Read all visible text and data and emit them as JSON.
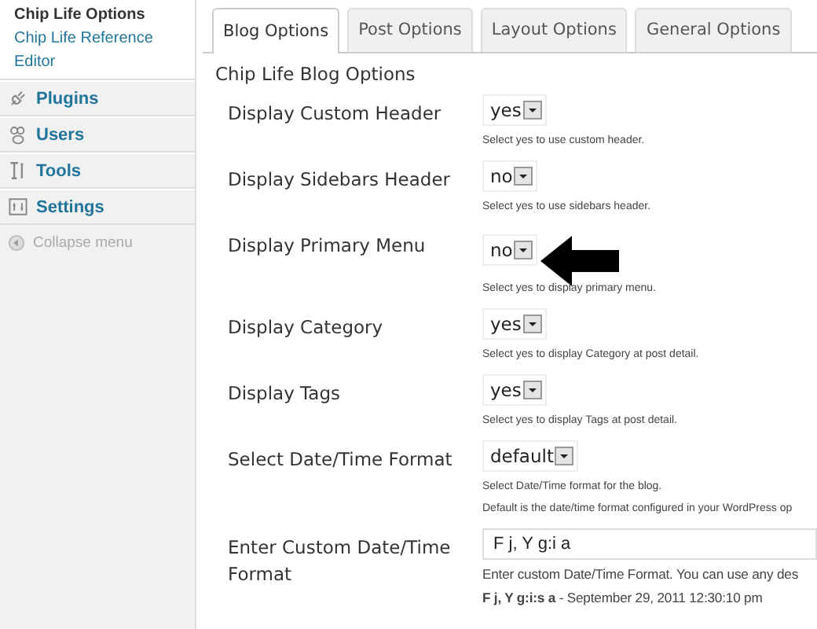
{
  "sidebar": {
    "submenu": [
      {
        "label": "Chip Life Options",
        "selected": true
      },
      {
        "label": "Chip Life Reference",
        "selected": false
      },
      {
        "label": "Editor",
        "selected": false
      }
    ],
    "items": [
      {
        "label": "Plugins"
      },
      {
        "label": "Users"
      },
      {
        "label": "Tools"
      },
      {
        "label": "Settings"
      }
    ],
    "collapse": "Collapse menu"
  },
  "tabs": [
    {
      "label": "Blog Options",
      "selected": true
    },
    {
      "label": "Post Options",
      "selected": false
    },
    {
      "label": "Layout Options",
      "selected": false
    },
    {
      "label": "General Options",
      "selected": false
    }
  ],
  "heading": "Chip Life Blog Options",
  "options": [
    {
      "kind": "select",
      "label": "Display Custom Header",
      "value": "yes",
      "help": [
        "Select yes to use custom header."
      ]
    },
    {
      "kind": "select",
      "label": "Display Sidebars Header",
      "value": "no",
      "help": [
        "Select yes to use sidebars header."
      ]
    },
    {
      "kind": "select",
      "label": "Display Primary Menu",
      "value": "no",
      "help": [
        "Select yes to display primary menu."
      ],
      "pointer": true
    },
    {
      "kind": "select",
      "label": "Display Category",
      "value": "yes",
      "help": [
        "Select yes to display Category at post detail."
      ]
    },
    {
      "kind": "select",
      "label": "Display Tags",
      "value": "yes",
      "help": [
        "Select yes to display Tags at post detail."
      ]
    },
    {
      "kind": "select",
      "label": "Select Date/Time Format",
      "value": "default",
      "help": [
        "Select Date/Time format for the blog.",
        "Default is the date/time format configured in your WordPress op"
      ]
    },
    {
      "kind": "text",
      "label": "Enter Custom Date/Time Format",
      "value": "F j, Y g:i a",
      "help": [
        "Enter custom Date/Time Format. You can use any des",
        "**F j, Y g:i:s a** - September 29, 2011 12:30:10 pm"
      ]
    }
  ]
}
